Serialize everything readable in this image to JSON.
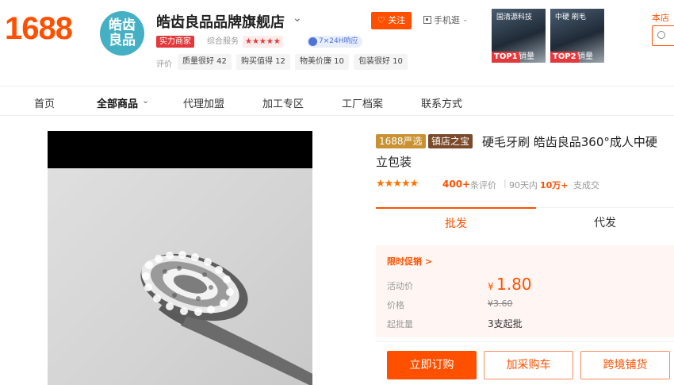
{
  "header": {
    "logo": "1688",
    "shop_avatar": [
      "皓齿",
      "良品"
    ],
    "shop_name": "皓齿良品品牌旗舰店",
    "shop_caret": "⌄",
    "power_badge": "实力商家",
    "service_label": "综合服务",
    "service_stars": "★★★★★",
    "response_badge": "7×24H响应",
    "rating_label": "评价",
    "ratings": [
      "质量很好 42",
      "购买值得 12",
      "物美价廉 10",
      "包装很好 10"
    ],
    "follow_label": "关注",
    "mobile_label": "手机逛",
    "top_products": [
      {
        "rank": "TOP1",
        "sales": "销量",
        "caption": "国清源科技"
      },
      {
        "rank": "TOP2",
        "sales": "销量",
        "caption": "中硬 刷毛"
      }
    ],
    "shop_search_label": "本店"
  },
  "nav": {
    "items": [
      "首页",
      "全部商品",
      "代理加盟",
      "加工专区",
      "工厂档案",
      "联系方式"
    ],
    "caret": "⌄"
  },
  "product": {
    "tag_yanxuan": "1688严选",
    "tag_zhendian": "镇店之宝",
    "title_line1": "硬毛牙刷 皓齿良品360°成人中硬",
    "title_line2": "立包装",
    "stars": "★★★★★",
    "review_count": "400+",
    "review_label": "条评价",
    "separator": "|",
    "days_label": "90天内",
    "deal_count": "10万+",
    "deal_label": "支成交",
    "rating_value": 4.5
  },
  "tabs": {
    "wholesale": "批发",
    "dropship": "代发"
  },
  "pricing": {
    "promo_link": "限时促销 >",
    "activity_label": "活动价",
    "currency": "¥",
    "activity_price": "1.80",
    "price_label": "价格",
    "original_price": "¥3.60",
    "min_order_label": "起批量",
    "min_order": "3支起批"
  },
  "actions": {
    "buy": "立即订购",
    "cart": "加采购车",
    "cross_border": "跨境铺货"
  },
  "colors": {
    "brand": "#ff5000",
    "tag_gold": "#c89233",
    "tag_brown": "#7a4a2a"
  }
}
